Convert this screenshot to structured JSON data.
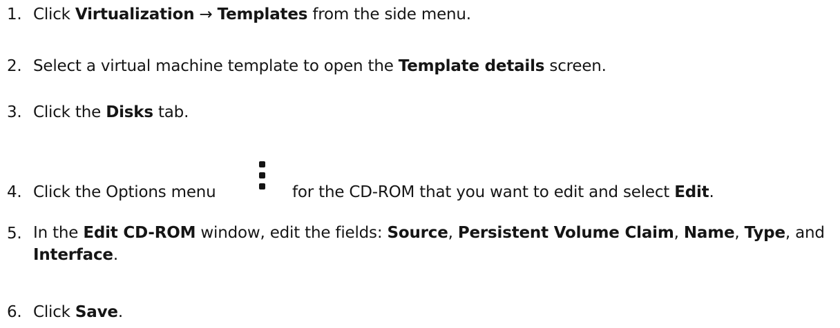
{
  "steps": [
    {
      "number": "1.",
      "text_1": "Click ",
      "bold_1": "Virtualization",
      "text_2": " → ",
      "bold_2": "Templates",
      "text_3": " from the side menu."
    },
    {
      "number": "2.",
      "text_1": "Select a virtual machine template to open the ",
      "bold_1": "Template details",
      "text_2": " screen."
    },
    {
      "number": "3.",
      "text_1": "Click the ",
      "bold_1": "Disks",
      "text_2": " tab."
    },
    {
      "number": "4.",
      "text_1": "Click the Options menu",
      "icon": "kebab-vertical-icon",
      "text_2": "for the CD-ROM that you want to edit and select ",
      "bold_1": "Edit",
      "text_3": "."
    },
    {
      "number": "5.",
      "text_1": "In the ",
      "bold_1": "Edit CD-ROM",
      "text_2": " window, edit the fields: ",
      "bold_2": "Source",
      "text_3": ", ",
      "bold_3": "Persistent Volume Claim",
      "text_4": ", ",
      "bold_4": "Name",
      "text_5": ", ",
      "bold_5": "Type",
      "text_6": ", and ",
      "bold_6": "Interface",
      "text_7": "."
    },
    {
      "number": "6.",
      "text_1": "Click ",
      "bold_1": "Save",
      "text_2": "."
    }
  ]
}
